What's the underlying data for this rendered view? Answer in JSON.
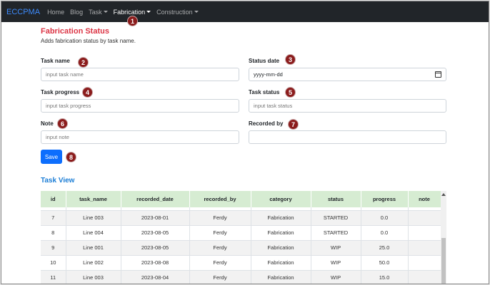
{
  "navbar": {
    "brand": "ECCPMA",
    "items": [
      {
        "label": "Home",
        "dropdown": false,
        "active": false
      },
      {
        "label": "Blog",
        "dropdown": false,
        "active": false
      },
      {
        "label": "Task",
        "dropdown": true,
        "active": false
      },
      {
        "label": "Fabrication",
        "dropdown": true,
        "active": true
      },
      {
        "label": "Construction",
        "dropdown": true,
        "active": false
      }
    ]
  },
  "form": {
    "title": "Fabrication Status",
    "subtitle": "Adds fabrication status by task name.",
    "task_name": {
      "label": "Task name",
      "placeholder": "input task name",
      "value": ""
    },
    "status_date": {
      "label": "Status date",
      "placeholder": "yyyy-mm-dd",
      "value": ""
    },
    "task_progress": {
      "label": "Task progress",
      "placeholder": "input task progress",
      "value": ""
    },
    "task_status": {
      "label": "Task status",
      "placeholder": "input task status",
      "value": ""
    },
    "note": {
      "label": "Note",
      "placeholder": "input note",
      "value": ""
    },
    "recorded_by": {
      "label": "Recorded by",
      "placeholder": "",
      "value": ""
    },
    "save_label": "Save"
  },
  "annotations": [
    "1",
    "2",
    "3",
    "4",
    "5",
    "6",
    "7",
    "8"
  ],
  "task_view": {
    "title": "Task View",
    "columns": [
      "id",
      "task_name",
      "recorded_date",
      "recorded_by",
      "category",
      "status",
      "progress",
      "note"
    ],
    "rows": [
      [
        "7",
        "Line 003",
        "2023-08-01",
        "Ferdy",
        "Fabrication",
        "STARTED",
        "0.0",
        ""
      ],
      [
        "8",
        "Line 004",
        "2023-08-05",
        "Ferdy",
        "Fabrication",
        "STARTED",
        "0.0",
        ""
      ],
      [
        "9",
        "Line 001",
        "2023-08-05",
        "Ferdy",
        "Fabrication",
        "WIP",
        "25.0",
        ""
      ],
      [
        "10",
        "Line 002",
        "2023-08-08",
        "Ferdy",
        "Fabrication",
        "WIP",
        "50.0",
        ""
      ],
      [
        "11",
        "Line 003",
        "2023-08-04",
        "Ferdy",
        "Fabrication",
        "WIP",
        "15.0",
        ""
      ]
    ]
  },
  "colors": {
    "navbar_bg": "#212529",
    "brand": "#3d8bfd",
    "title": "#dc3545",
    "section_title": "#1c7ed6",
    "primary_button": "#0d6efd",
    "table_header_bg": "#d6ecd2",
    "badge": "#8b1c1c"
  }
}
